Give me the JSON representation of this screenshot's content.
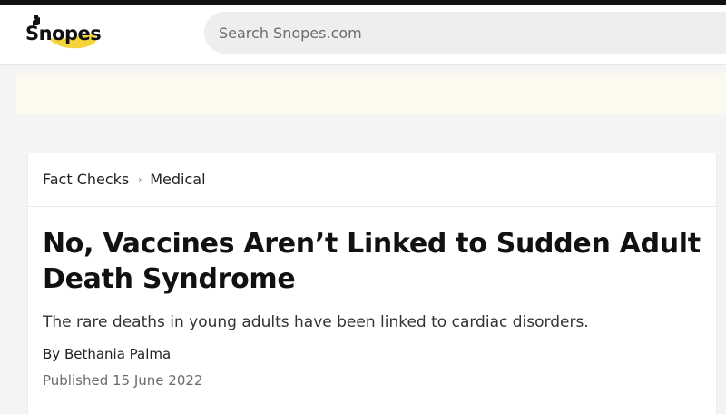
{
  "header": {
    "logo_text": "Snopes",
    "search_placeholder": "Search Snopes.com"
  },
  "breadcrumb": {
    "items": [
      "Fact Checks",
      "Medical"
    ],
    "separator": "›"
  },
  "article": {
    "title": "No, Vaccines Aren’t Linked to Sudden Adult Death Syndrome",
    "subtitle": "The rare deaths in young adults have been linked to cardiac disorders.",
    "byline_prefix": "By",
    "author": "Bethania Palma",
    "published_label": "Published",
    "published_date": "15 June 2022"
  },
  "colors": {
    "logo_yellow": "#f5d33a",
    "ad_band": "#fcfaee",
    "search_bg": "#eeeeee"
  }
}
